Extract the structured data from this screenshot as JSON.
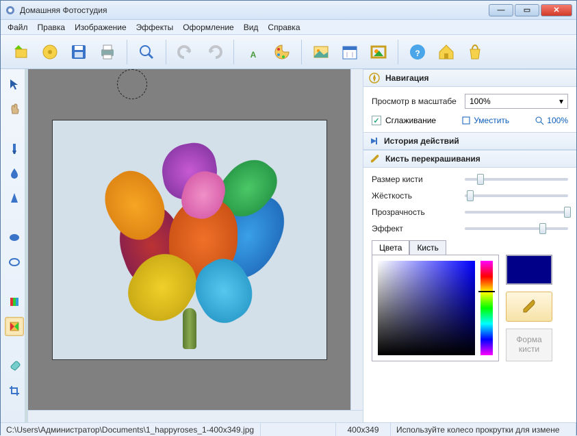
{
  "window": {
    "title": "Домашняя Фотостудия"
  },
  "menu": [
    "Файл",
    "Правка",
    "Изображение",
    "Эффекты",
    "Оформление",
    "Вид",
    "Справка"
  ],
  "nav": {
    "title": "Навигация",
    "zoom_label": "Просмотр в масштабе",
    "zoom_value": "100%",
    "smoothing": "Сглаживание",
    "fit": "Уместить",
    "hundred": "100%"
  },
  "history": {
    "title": "История действий"
  },
  "brush": {
    "title": "Кисть перекрашивания",
    "size": "Размер кисти",
    "hardness": "Жёсткость",
    "opacity": "Прозрачность",
    "effect": "Эффект",
    "tabs": {
      "colors": "Цвета",
      "brush": "Кисть"
    },
    "shape": "Форма\nкисти",
    "swatch_color": "#000088"
  },
  "sliders": {
    "size": 0.12,
    "hardness": 0.02,
    "opacity": 0.98,
    "effect": 0.72
  },
  "status": {
    "path": "C:\\Users\\Администратор\\Documents\\1_happyroses_1-400x349.jpg",
    "dims": "400x349",
    "hint": "Используйте колесо прокрутки для измене"
  }
}
